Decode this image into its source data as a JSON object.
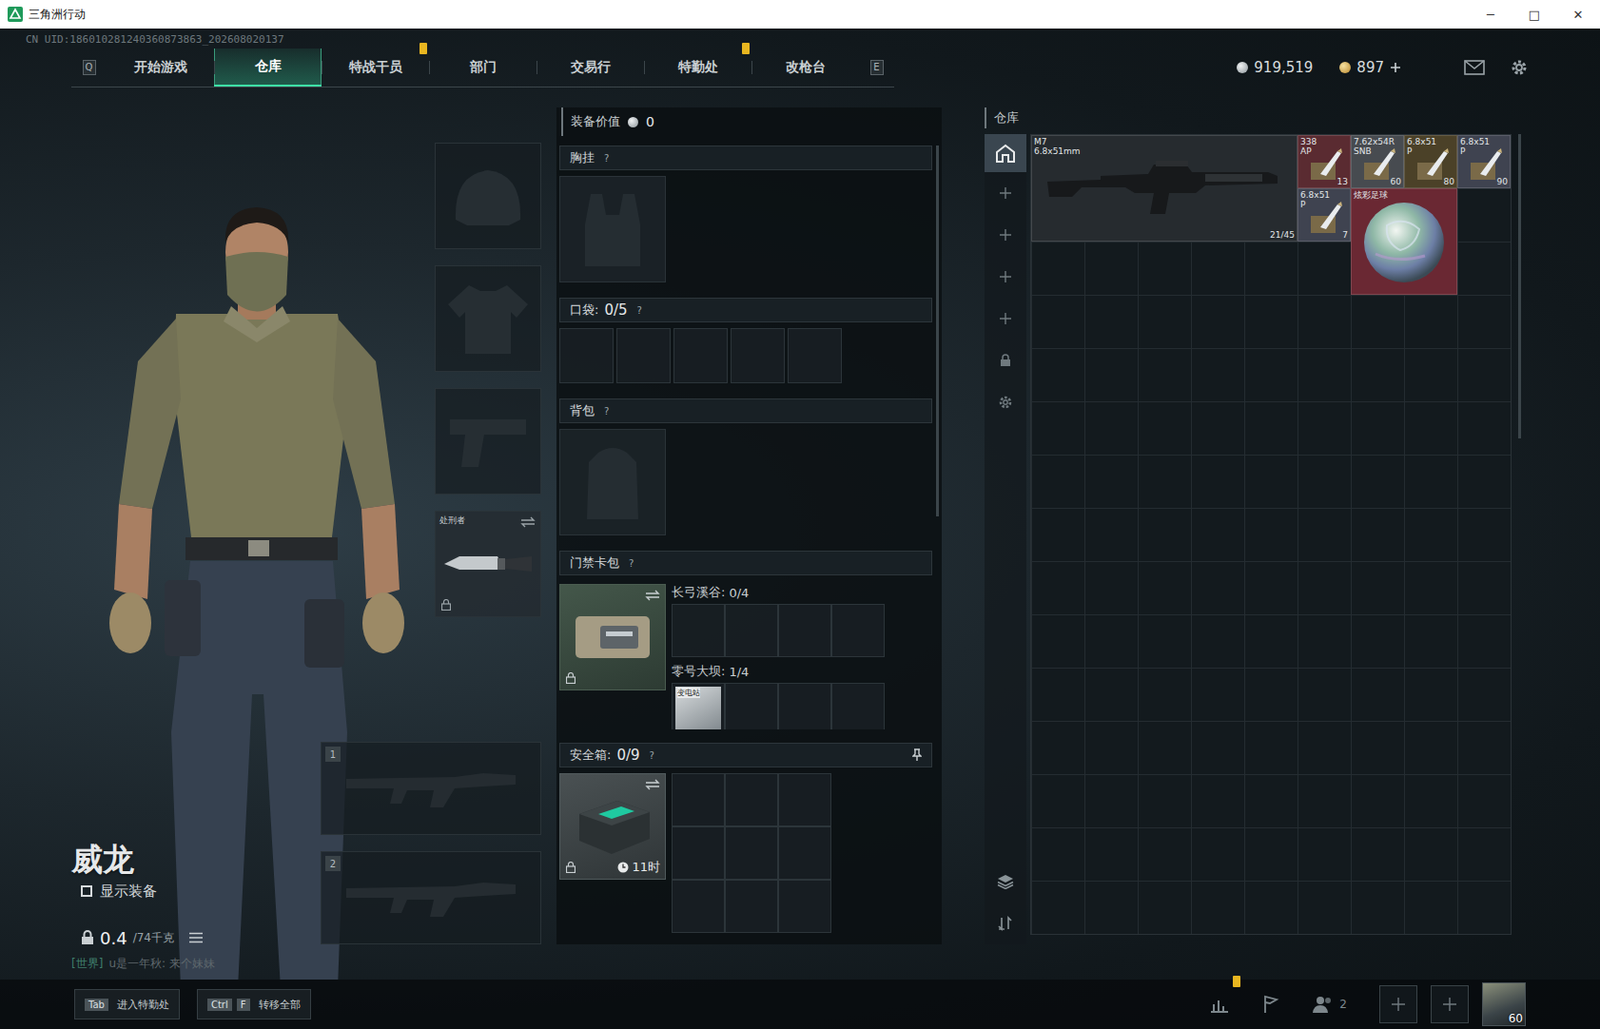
{
  "window": {
    "title": "三角洲行动",
    "controls": [
      "─",
      "□",
      "✕"
    ]
  },
  "uid": "CN UID:186010281240360873863_202608020137",
  "nav": {
    "prev_key": "Q",
    "next_key": "E",
    "tabs": [
      {
        "label": "开始游戏",
        "selected": false,
        "badge": false
      },
      {
        "label": "仓库",
        "selected": true,
        "badge": false
      },
      {
        "label": "特战干员",
        "selected": false,
        "badge": true
      },
      {
        "label": "部门",
        "selected": false,
        "badge": false
      },
      {
        "label": "交易行",
        "selected": false,
        "badge": false
      },
      {
        "label": "特勤处",
        "selected": false,
        "badge": true
      },
      {
        "label": "改枪台",
        "selected": false,
        "badge": false
      }
    ]
  },
  "wallet": {
    "coins": "919,519",
    "tokens": "897"
  },
  "operator": {
    "name": "威龙",
    "show_gear": {
      "label": "显示装备",
      "checked": false
    },
    "weight": "0.4",
    "capacity": "/74千克",
    "locked": true
  },
  "chat": {
    "channel": "[世界]",
    "text": "u是一年秋: 来个妹妹"
  },
  "gear_slots": [
    {
      "kind": "helmet",
      "label": "",
      "filled": false,
      "locked": false,
      "swappable": false
    },
    {
      "kind": "armor",
      "label": "",
      "filled": false,
      "locked": false,
      "swappable": false
    },
    {
      "kind": "pistol",
      "label": "",
      "filled": false,
      "locked": false,
      "swappable": false
    },
    {
      "kind": "melee",
      "label": "处刑者",
      "filled": true,
      "locked": true,
      "swappable": true
    }
  ],
  "weapon_slots": [
    {
      "number": "1",
      "filled": false
    },
    {
      "number": "2",
      "filled": false
    }
  ],
  "loadout": {
    "value_label": "装备价值",
    "value": "0",
    "chest": {
      "title": "胸挂",
      "help": "?",
      "filled": false
    },
    "pockets": {
      "title": "口袋:",
      "count": "0/5",
      "help": "?",
      "slots": [
        {
          "filled": false
        },
        {
          "filled": false
        },
        {
          "filled": false
        },
        {
          "filled": false
        },
        {
          "filled": false
        }
      ]
    },
    "backpack": {
      "title": "背包",
      "help": "?",
      "filled": false
    },
    "keycards": {
      "title": "门禁卡包",
      "help": "?",
      "locked": true,
      "swappable": true,
      "maps": [
        {
          "name": "长弓溪谷:",
          "count": "0/4",
          "slots": [
            {
              "filled": false,
              "label": ""
            },
            {
              "filled": false,
              "label": ""
            },
            {
              "filled": false,
              "label": ""
            },
            {
              "filled": false,
              "label": ""
            }
          ]
        },
        {
          "name": "零号大坝:",
          "count": "1/4",
          "slots": [
            {
              "filled": true,
              "label": "变电站"
            },
            {
              "filled": false,
              "label": ""
            },
            {
              "filled": false,
              "label": ""
            },
            {
              "filled": false,
              "label": ""
            }
          ]
        }
      ]
    },
    "safebox": {
      "title": "安全箱:",
      "count": "0/9",
      "help": "?",
      "timer": "11时",
      "locked": true,
      "swappable": true,
      "pinned": true,
      "slots": [
        {
          "filled": false
        },
        {
          "filled": false
        },
        {
          "filled": false
        },
        {
          "filled": false
        },
        {
          "filled": false
        },
        {
          "filled": false
        },
        {
          "filled": false
        },
        {
          "filled": false
        },
        {
          "filled": false
        }
      ]
    }
  },
  "warehouse": {
    "title": "仓库",
    "columns": 9,
    "rows": 15,
    "tools": [
      {
        "kind": "home",
        "selected": true
      },
      {
        "kind": "add",
        "selected": false
      },
      {
        "kind": "add",
        "selected": false
      },
      {
        "kind": "add",
        "selected": false
      },
      {
        "kind": "add",
        "selected": false
      },
      {
        "kind": "lock",
        "selected": false
      },
      {
        "kind": "settings",
        "selected": false
      }
    ],
    "bottom_tools": [
      {
        "kind": "layers",
        "selected": false
      },
      {
        "kind": "sort",
        "selected": false
      }
    ],
    "items": [
      {
        "kind": "weapon",
        "name": "M7",
        "sub": "6.8x51mm",
        "count": "21/45",
        "col": 0,
        "row": 0,
        "w": 5,
        "h": 2,
        "color": "#262b2f"
      },
      {
        "kind": "ammo",
        "name": "338",
        "sub": "AP",
        "count": "13",
        "col": 5,
        "row": 0,
        "w": 1,
        "h": 1,
        "color": "#5a2b31"
      },
      {
        "kind": "ammo",
        "name": "7.62x54R",
        "sub": "SNB",
        "count": "60",
        "col": 6,
        "row": 0,
        "w": 1,
        "h": 1,
        "color": "#474b50"
      },
      {
        "kind": "ammo",
        "name": "6.8x51",
        "sub": "P",
        "count": "80",
        "col": 7,
        "row": 0,
        "w": 1,
        "h": 1,
        "color": "#4b4128"
      },
      {
        "kind": "ammo",
        "name": "6.8x51",
        "sub": "P",
        "count": "90",
        "col": 8,
        "row": 0,
        "w": 1,
        "h": 1,
        "color": "#3f4350"
      },
      {
        "kind": "ammo",
        "name": "6.8x51",
        "sub": "P",
        "count": "7",
        "col": 5,
        "row": 1,
        "w": 1,
        "h": 1,
        "color": "#3f4350"
      },
      {
        "kind": "collectible",
        "name": "炫彩足球",
        "sub": "",
        "count": "",
        "col": 6,
        "row": 1,
        "w": 2,
        "h": 2,
        "color": "#6a2833"
      }
    ]
  },
  "bottom_bar": {
    "hotkeys": [
      {
        "keys": [
          "Tab"
        ],
        "label": "进入特勤处"
      },
      {
        "keys": [
          "Ctrl",
          "F"
        ],
        "label": "转移全部"
      }
    ],
    "stats_badge": true,
    "friends": "2",
    "party_slots": [
      {
        "filled": false
      },
      {
        "filled": false
      }
    ],
    "level": "60"
  }
}
